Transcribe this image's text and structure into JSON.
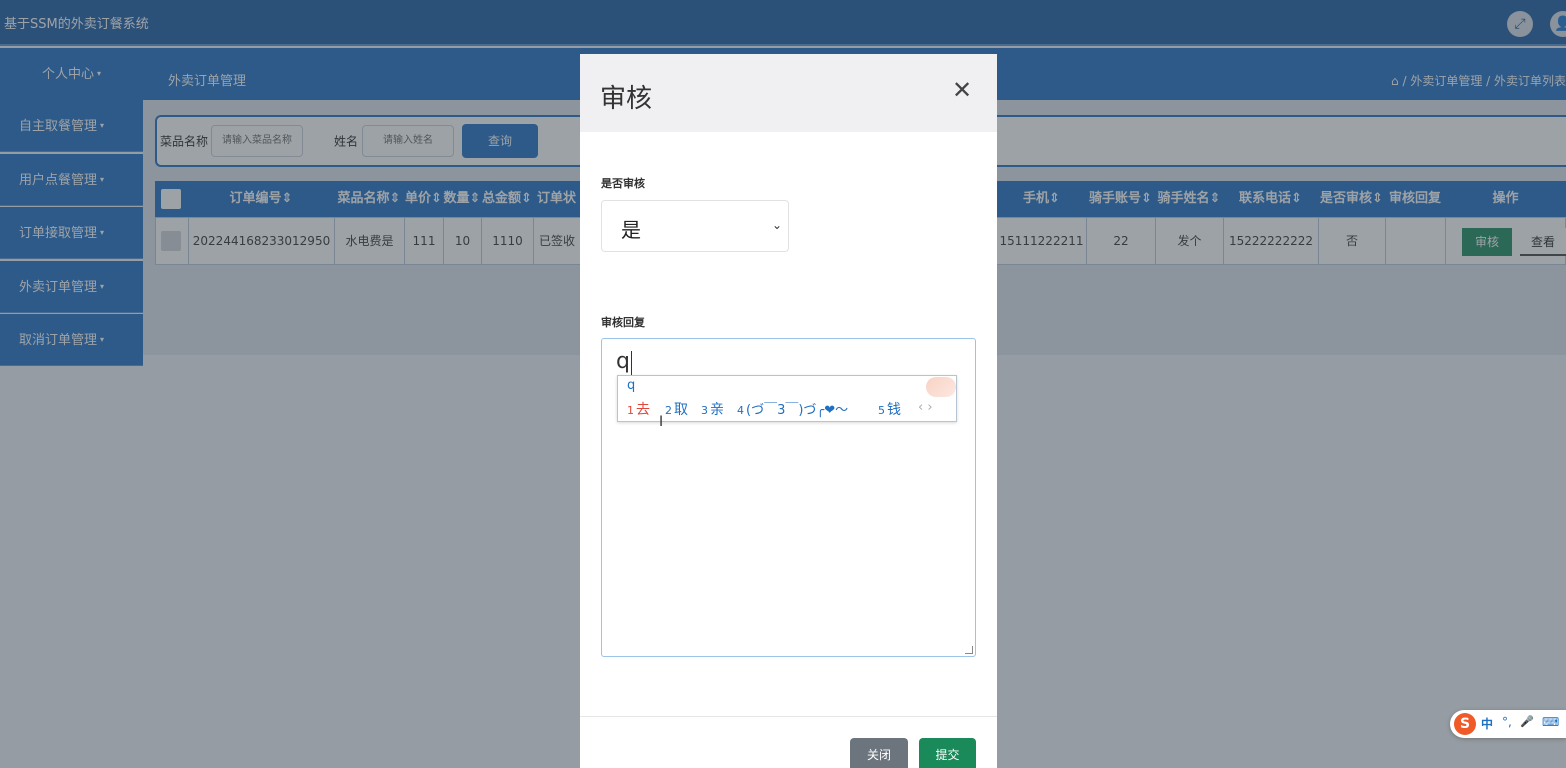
{
  "app": {
    "title": "基于SSM的外卖订餐系统"
  },
  "topbar": {
    "fullscreen_icon": "⤢",
    "user_icon": "👤"
  },
  "nav": {
    "personal": "个人中心",
    "page_heading": "外卖订单管理",
    "breadcrumb": "⌂ / 外卖订单管理 / 外卖订单列表"
  },
  "sidebar": {
    "items": [
      {
        "label": "自主取餐管理"
      },
      {
        "label": "用户点餐管理"
      },
      {
        "label": "订单接取管理"
      },
      {
        "label": "外卖订单管理"
      },
      {
        "label": "取消订单管理"
      }
    ]
  },
  "search": {
    "dish_label": "菜品名称",
    "dish_placeholder": "请输入菜品名称",
    "name_label": "姓名",
    "name_placeholder": "请输入姓名",
    "query_button": "查询"
  },
  "table": {
    "headers": [
      "订单编号",
      "菜品名称",
      "单价",
      "数量",
      "总金额",
      "订单状",
      "手机",
      "骑手账号",
      "骑手姓名",
      "联系电话",
      "是否审核",
      "审核回复",
      "操作"
    ],
    "row": {
      "order_no": "202244168233012950",
      "dish": "水电费是",
      "price": "111",
      "qty": "10",
      "total": "1110",
      "status": "已签收",
      "phone": "15111222211",
      "rider_account": "22",
      "rider_name": "发个",
      "contact": "15222222222",
      "audited": "否",
      "reply": "",
      "audit_btn": "审核",
      "view_btn": "查看"
    }
  },
  "modal": {
    "title": "审核",
    "close_icon": "✕",
    "audit_label": "是否审核",
    "audit_value": "是",
    "reply_label": "审核回复",
    "reply_value": "q",
    "close_button": "关闭",
    "submit_button": "提交"
  },
  "ime": {
    "input": "q",
    "candidates": [
      {
        "n": "1",
        "text": "去"
      },
      {
        "n": "2",
        "text": "取"
      },
      {
        "n": "3",
        "text": "亲"
      },
      {
        "n": "4",
        "text": "(づ￣3￣)づ╭❤～"
      },
      {
        "n": "5",
        "text": "钱"
      }
    ],
    "nav": "‹ ›",
    "bar": {
      "logo": "S",
      "lang": "中",
      "punct": "°,",
      "mic": "🎤",
      "keyboard": "⌨"
    }
  },
  "colors": {
    "primary": "#1f6fc2",
    "topbar": "#1c5da3",
    "success": "#1a8a5a",
    "secondary": "#6c757d"
  }
}
